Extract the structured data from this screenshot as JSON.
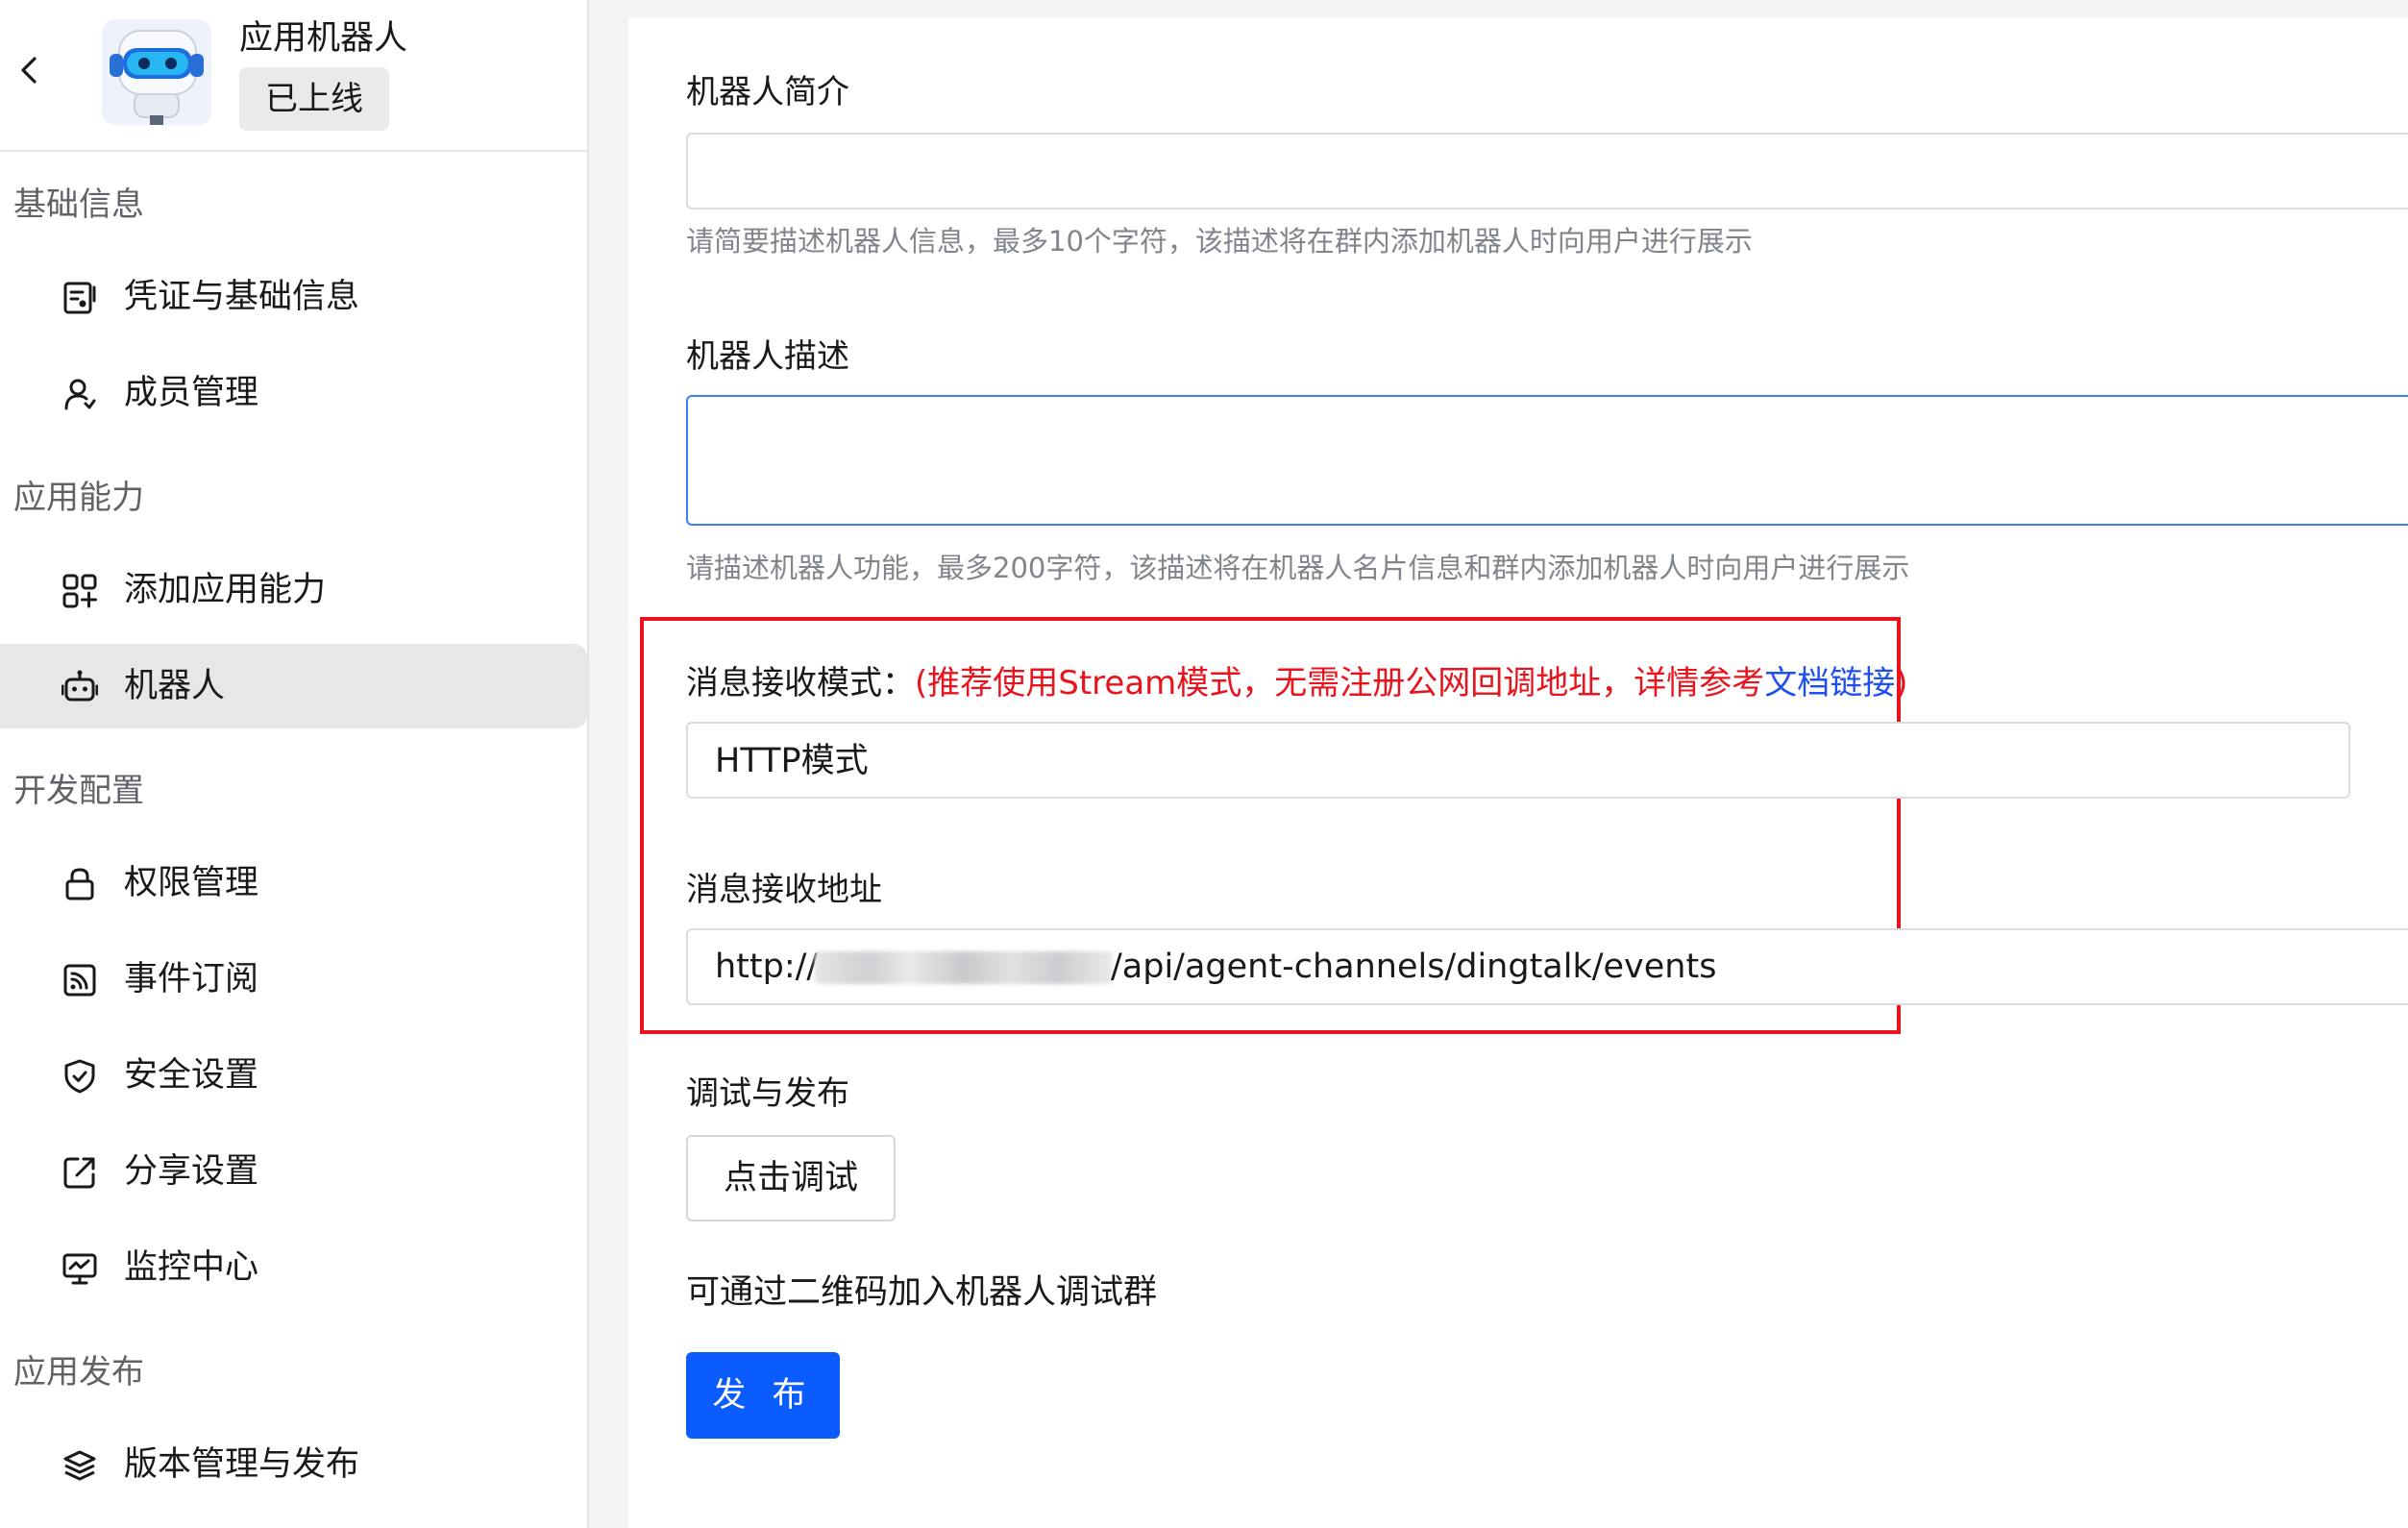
{
  "app": {
    "name": "应用机器人",
    "status": "已上线"
  },
  "sidebar": {
    "groups": [
      {
        "title": "基础信息",
        "items": [
          {
            "label": "凭证与基础信息",
            "icon": "credential-icon"
          },
          {
            "label": "成员管理",
            "icon": "user-icon"
          }
        ]
      },
      {
        "title": "应用能力",
        "items": [
          {
            "label": "添加应用能力",
            "icon": "add-grid-icon"
          },
          {
            "label": "机器人",
            "icon": "robot-icon",
            "active": true
          }
        ]
      },
      {
        "title": "开发配置",
        "items": [
          {
            "label": "权限管理",
            "icon": "lock-icon"
          },
          {
            "label": "事件订阅",
            "icon": "rss-icon"
          },
          {
            "label": "安全设置",
            "icon": "shield-icon"
          },
          {
            "label": "分享设置",
            "icon": "share-icon"
          },
          {
            "label": "监控中心",
            "icon": "monitor-icon"
          }
        ]
      },
      {
        "title": "应用发布",
        "items": [
          {
            "label": "版本管理与发布",
            "icon": "layers-icon"
          }
        ]
      }
    ]
  },
  "form": {
    "intro": {
      "label": "机器人简介",
      "value": "",
      "hint": "请简要描述机器人信息，最多10个字符，该描述将在群内添加机器人时向用户进行展示"
    },
    "description": {
      "label": "机器人描述",
      "value": "",
      "hint": "请描述机器人功能，最多200字符，该描述将在机器人名片信息和群内添加机器人时向用户进行展示"
    },
    "message_mode": {
      "label": "消息接收模式：",
      "note_prefix": "(推荐使用Stream模式，无需注册公网回调地址，详情参考",
      "note_link": "文档链接",
      "note_suffix": ")",
      "value": "HTTP模式"
    },
    "message_url": {
      "label": "消息接收地址",
      "value_prefix": "http://",
      "value_suffix": "/api/agent-channels/dingtalk/events"
    },
    "debug": {
      "label": "调试与发布",
      "button": "点击调试",
      "qr_text": "可通过二维码加入机器人调试群"
    },
    "publish_button": "发 布"
  },
  "colors": {
    "primary": "#0b5cff",
    "highlight_border": "#e8131c",
    "link": "#1f4ff0",
    "active_bg": "#e6e7e9"
  }
}
